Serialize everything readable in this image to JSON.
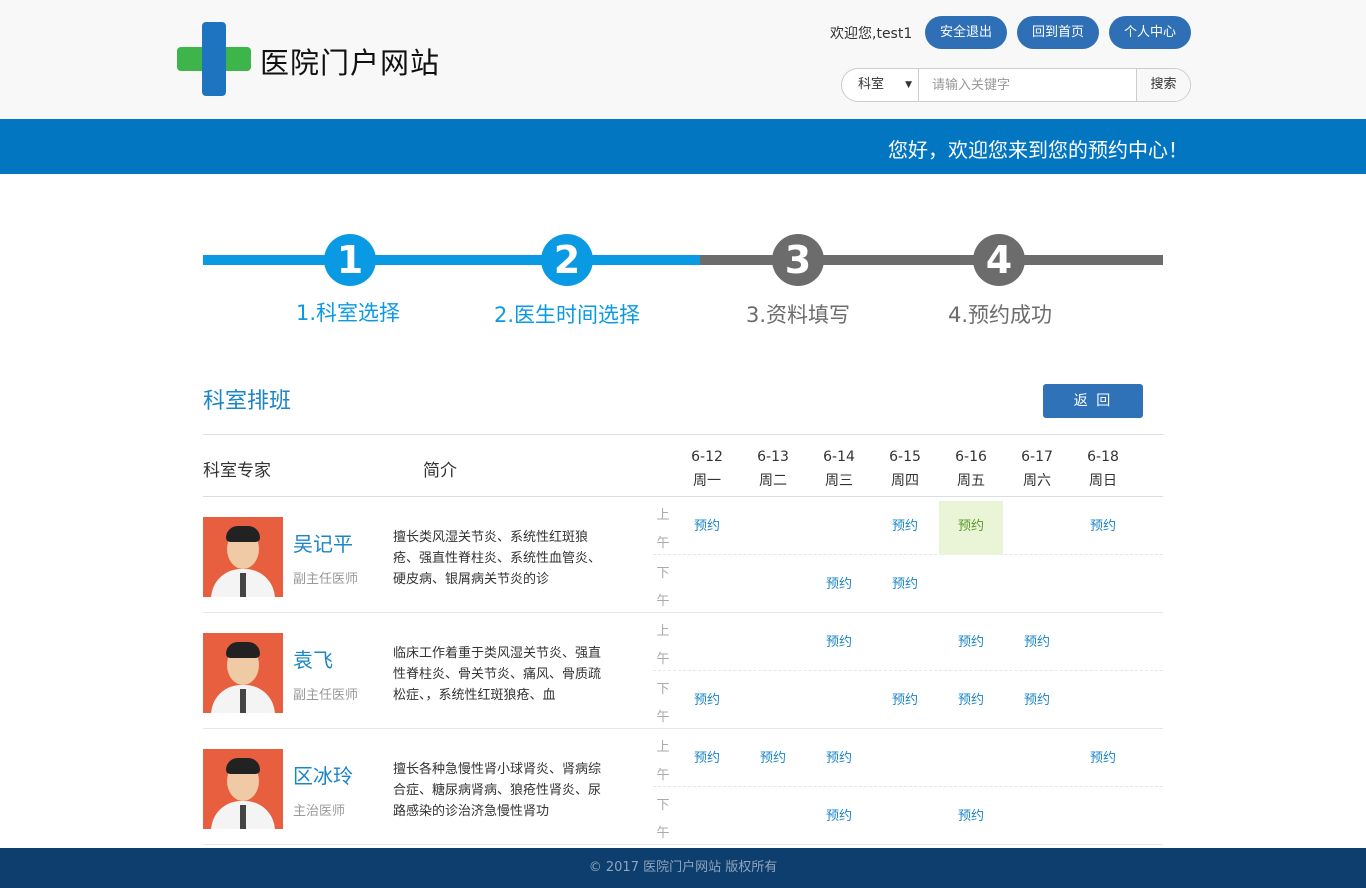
{
  "header": {
    "site_name": "医院门户网站",
    "welcome": "欢迎您,test1",
    "buttons": {
      "logout": "安全退出",
      "home": "回到首页",
      "profile": "个人中心"
    },
    "search": {
      "category": "科室",
      "placeholder": "请输入关键字",
      "button": "搜索"
    }
  },
  "banner": {
    "text": "您好，欢迎您来到您的预约中心！"
  },
  "steps": [
    {
      "number": "1",
      "label": "1.科室选择",
      "active": true
    },
    {
      "number": "2",
      "label": "2.医生时间选择",
      "active": true
    },
    {
      "number": "3",
      "label": "3.资料填写",
      "active": false
    },
    {
      "number": "4",
      "label": "4.预约成功",
      "active": false
    }
  ],
  "colors": {
    "active": "#0a9ae3",
    "inactive": "#6c6c6c",
    "accent": "#1a85c8",
    "banner": "#0376c2",
    "footer": "#0d3e6e"
  },
  "schedule": {
    "title": "科室排班",
    "back_button": "返 回",
    "headers": {
      "experts": "科室专家",
      "intro": "简介"
    },
    "days": [
      {
        "date": "6-12",
        "weekday": "周一"
      },
      {
        "date": "6-13",
        "weekday": "周二"
      },
      {
        "date": "6-14",
        "weekday": "周三"
      },
      {
        "date": "6-15",
        "weekday": "周四"
      },
      {
        "date": "6-16",
        "weekday": "周五"
      },
      {
        "date": "6-17",
        "weekday": "周六"
      },
      {
        "date": "6-18",
        "weekday": "周日"
      }
    ],
    "am_label": "上午",
    "pm_label": "下午",
    "slot_text": "预约",
    "doctors": [
      {
        "name": "吴记平",
        "title": "副主任医师",
        "intro": "擅长类风湿关节炎、系统性红斑狼疮、强直性脊柱炎、系统性血管炎、硬皮病、银屑病关节炎的诊",
        "am": [
          1,
          0,
          0,
          1,
          2,
          0,
          1
        ],
        "pm": [
          0,
          0,
          1,
          1,
          0,
          0,
          0
        ]
      },
      {
        "name": "袁飞",
        "title": "副主任医师",
        "intro": "临床工作着重于类风湿关节炎、强直性脊柱炎、骨关节炎、痛风、骨质疏松症、，系统性红斑狼疮、血",
        "am": [
          0,
          0,
          1,
          0,
          1,
          1,
          0
        ],
        "pm": [
          1,
          0,
          0,
          1,
          1,
          1,
          0
        ]
      },
      {
        "name": "区冰玲",
        "title": "主治医师",
        "intro": "擅长各种急慢性肾小球肾炎、肾病综合症、糖尿病肾病、狼疮性肾炎、尿路感染的诊治济急慢性肾功",
        "am": [
          1,
          1,
          1,
          0,
          0,
          0,
          1
        ],
        "pm": [
          0,
          0,
          1,
          0,
          1,
          0,
          0
        ]
      }
    ]
  },
  "footer": {
    "text": "© 2017 医院门户网站 版权所有"
  }
}
